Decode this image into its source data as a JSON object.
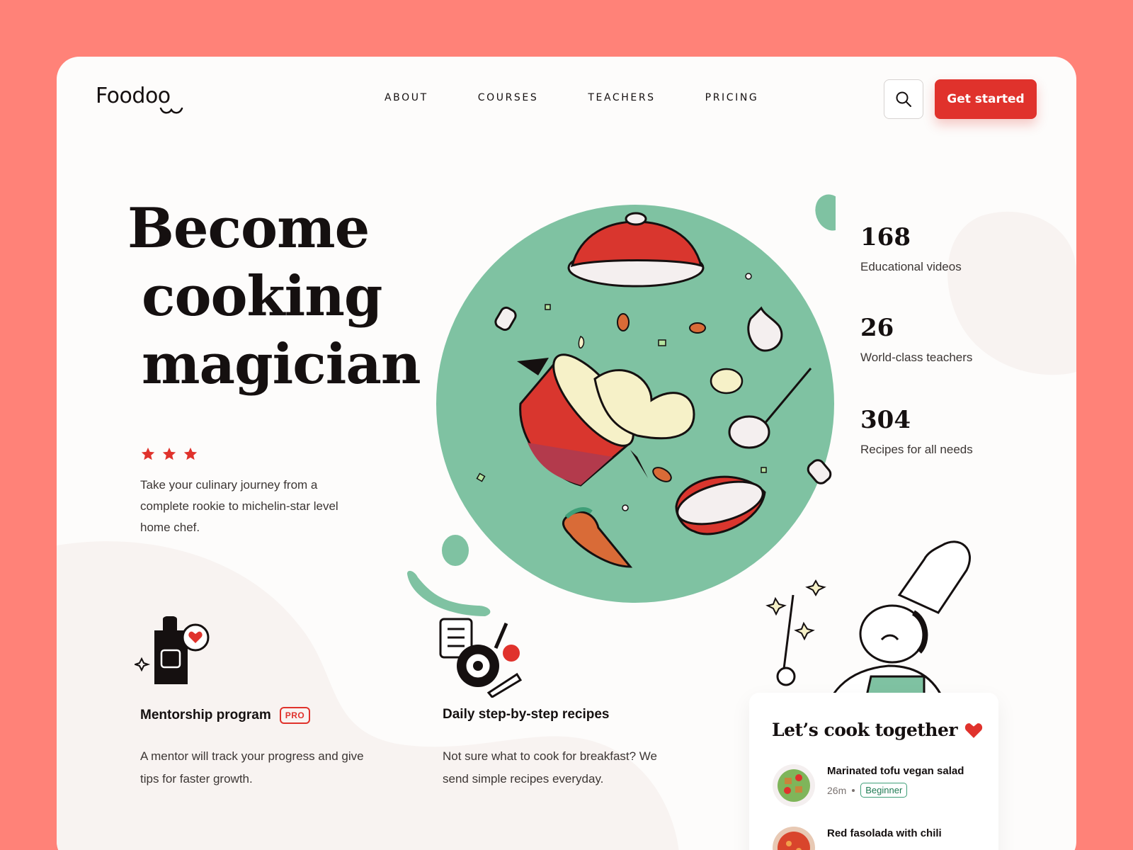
{
  "brand": {
    "name": "Foodoo"
  },
  "nav": {
    "items": [
      "ABOUT",
      "COURSES",
      "TEACHERS",
      "PRICING"
    ]
  },
  "header": {
    "cta_label": "Get started",
    "search_icon": "search-icon"
  },
  "hero": {
    "title_lines": [
      "Become",
      "cooking",
      "magician"
    ],
    "rating_stars": 3,
    "lead": "Take your culinary journey from a complete rookie to michelin-star level home chef."
  },
  "stats": [
    {
      "value": "168",
      "label": "Educational videos"
    },
    {
      "value": "26",
      "label": "World-class teachers"
    },
    {
      "value": "304",
      "label": "Recipes for all needs"
    }
  ],
  "features": [
    {
      "title": "Mentorship program",
      "badge": "PRO",
      "description": "A mentor will track your progress and give tips for faster growth.",
      "icon": "apron-icon"
    },
    {
      "title": "Daily step-by-step recipes",
      "description": "Not sure what to cook for breakfast? We send simple recipes everyday.",
      "icon": "recipe-pan-icon"
    }
  ],
  "recipes": {
    "title": "Let’s cook together",
    "items": [
      {
        "name": "Marinated tofu vegan salad",
        "time": "26m",
        "level": "Beginner"
      },
      {
        "name": "Red fasolada with chili"
      }
    ]
  },
  "colors": {
    "background": "#FF8278",
    "accent": "#E0322C",
    "green": "#7FC2A2",
    "text": "#151010"
  }
}
